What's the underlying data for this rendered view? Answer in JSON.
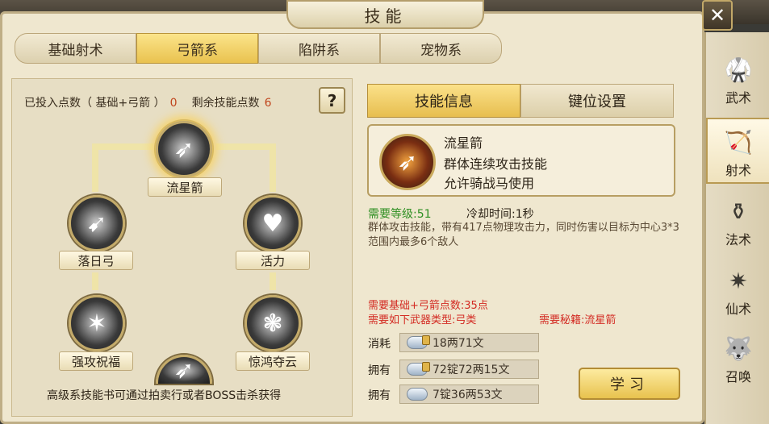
{
  "window": {
    "title": "技能"
  },
  "tabs": [
    {
      "label": "基础射术"
    },
    {
      "label": "弓箭系"
    },
    {
      "label": "陷阱系"
    },
    {
      "label": "宠物系"
    }
  ],
  "points": {
    "invested_label": "已投入点数（ 基础+弓箭 ）",
    "invested_value": "0",
    "remaining_label": "剩余技能点数",
    "remaining_value": "6"
  },
  "help_label": "?",
  "tree": {
    "nodes": [
      {
        "label": "流星箭"
      },
      {
        "label": "落日弓"
      },
      {
        "label": "活力"
      },
      {
        "label": "强攻祝福"
      },
      {
        "label": "惊鸿夺云"
      }
    ]
  },
  "hint": "高级系技能书可通过拍卖行或者BOSS击杀获得",
  "right_tabs": [
    {
      "label": "技能信息"
    },
    {
      "label": "键位设置"
    }
  ],
  "skill": {
    "name": "流星箭",
    "type": "群体连续攻击技能",
    "mount": "允许骑战马使用",
    "req_level": "需要等级:51",
    "cooldown": "冷却时间:1秒",
    "description": "群体攻击技能，带有417点物理攻击力，同时伤害以目标为中心3*3范围内最多6个敌人",
    "req_points": "需要基础+弓箭点数:35点",
    "req_weapon": "需要如下武器类型:弓类",
    "req_book": "需要秘籍:流星箭"
  },
  "costs": [
    {
      "label": "消耗",
      "value": "18两71文"
    },
    {
      "label": "拥有",
      "value": "72锭72两15文"
    },
    {
      "label": "拥有",
      "value": "7锭36两53文"
    }
  ],
  "learn_label": "学习",
  "close_label": "✕",
  "sidebar": [
    {
      "label": "武术",
      "icon": "fighter-icon"
    },
    {
      "label": "射术",
      "icon": "archery-icon"
    },
    {
      "label": "法术",
      "icon": "magic-gourd-icon"
    },
    {
      "label": "仙术",
      "icon": "shuriken-icon"
    },
    {
      "label": "召唤",
      "icon": "beast-mask-icon"
    }
  ],
  "colors": {
    "accent_gold": "#e9c24f",
    "req_red": "#d32a22",
    "level_green": "#2f8f23"
  }
}
